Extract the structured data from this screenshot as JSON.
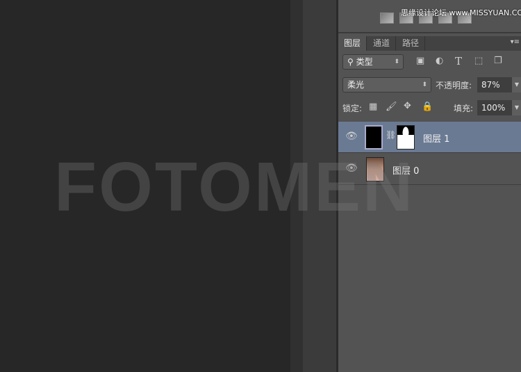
{
  "watermark": {
    "site": "思缘设计论坛 www.MISSYUAN.COM",
    "overlay": "FOTOMEN"
  },
  "tabs": [
    {
      "label": "图层",
      "active": true
    },
    {
      "label": "通道"
    },
    {
      "label": "路径"
    }
  ],
  "filter": {
    "value": "类型",
    "icons": [
      "image-filter-icon",
      "adjustment-filter-icon",
      "type-filter-icon",
      "shape-filter-icon",
      "smart-object-filter-icon"
    ]
  },
  "blend": {
    "mode": "柔光",
    "opacity_label": "不透明度:",
    "opacity": "87%"
  },
  "lock": {
    "label": "锁定:",
    "fill_label": "填充:",
    "fill": "100%"
  },
  "layers": [
    {
      "name": "图层 1",
      "selected": true,
      "has_mask": true
    },
    {
      "name": "图层 0",
      "selected": false
    }
  ],
  "colors": {
    "selected_layer": "#6a7a93",
    "panel": "#535353"
  }
}
